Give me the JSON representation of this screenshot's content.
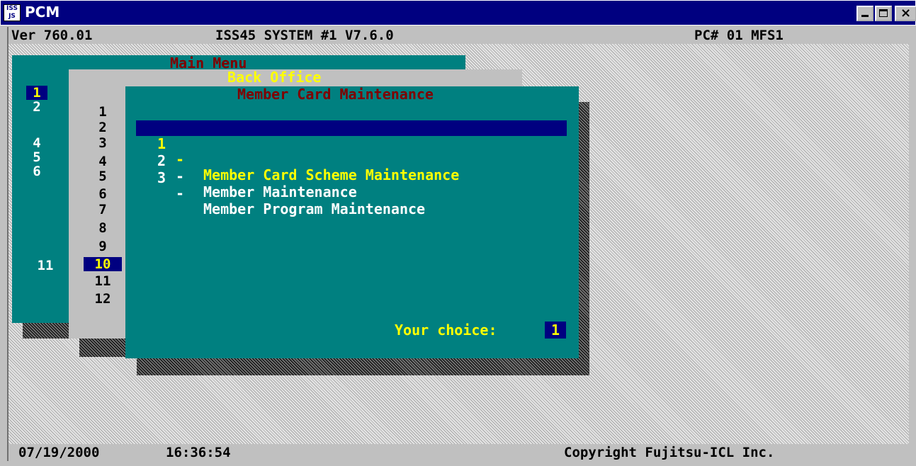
{
  "window": {
    "title": "PCM",
    "app_icon_text": "ISS JS"
  },
  "status_top": {
    "version": "Ver 760.01",
    "system": "ISS45 SYSTEM #1 V7.6.0",
    "pc": "PC# 01 MFS1"
  },
  "main_menu": {
    "title": "Main Menu",
    "numbers": [
      "1",
      "2",
      "4",
      "5",
      "6",
      "11"
    ],
    "selected": "1"
  },
  "back_office": {
    "title": "Back Office",
    "numbers": [
      "1",
      "2",
      "3",
      "4",
      "5",
      "6",
      "7",
      "8",
      "9",
      "10",
      "11",
      "12"
    ],
    "selected": "10"
  },
  "member_card": {
    "title": "Member Card Maintenance",
    "items": [
      {
        "num": "1",
        "label": "Member Card Scheme Maintenance"
      },
      {
        "num": "2",
        "label": "Member Maintenance"
      },
      {
        "num": "3",
        "label": "Member Program Maintenance"
      }
    ],
    "selected_index": 0,
    "choice_label": "Your choice:",
    "choice_value": "1"
  },
  "status_bottom": {
    "date": "07/19/2000",
    "time": "16:36:54",
    "copyright": "Copyright Fujitsu-ICL Inc."
  },
  "colors": {
    "title_bar": "#000080",
    "panel_teal": "#008080",
    "highlight": "#000080",
    "accent_yellow": "#ffff00",
    "title_red": "#800000"
  }
}
